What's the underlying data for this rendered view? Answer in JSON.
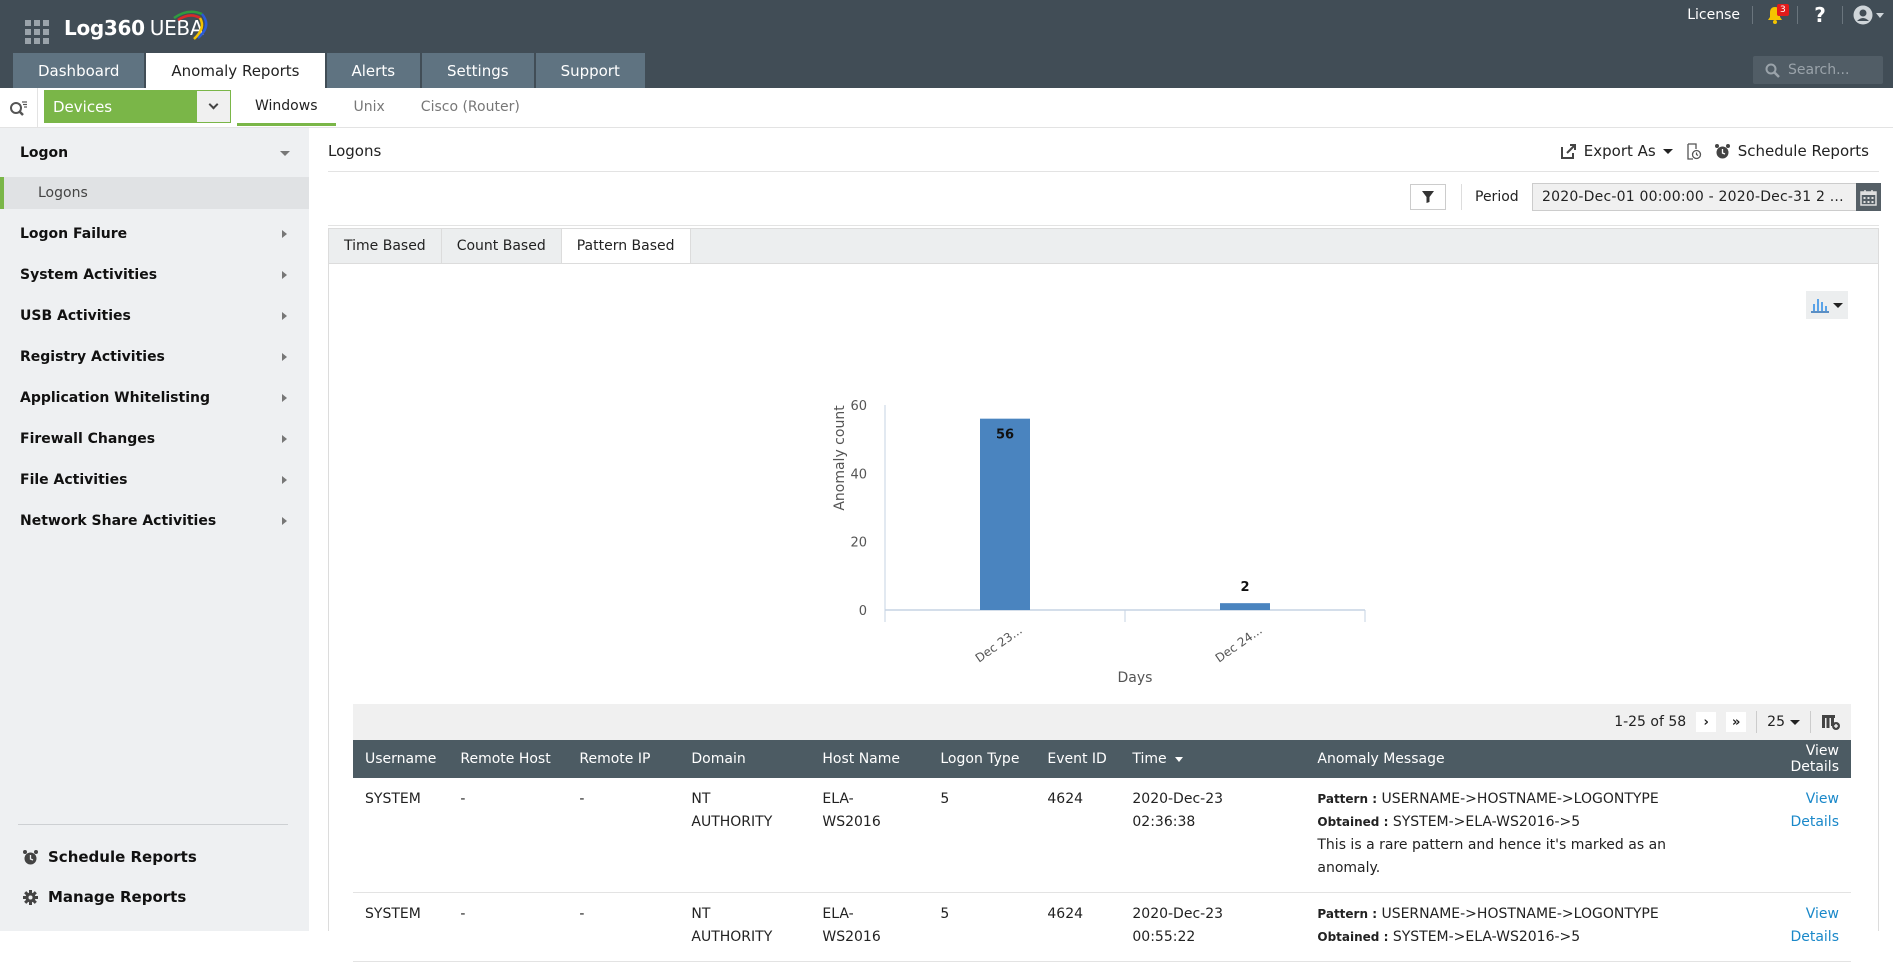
{
  "header": {
    "app_name": "Log360",
    "app_suffix": "UEBA",
    "license_label": "License",
    "notification_count": "3",
    "help_label": "?",
    "search_placeholder": "Search...",
    "main_tabs": [
      {
        "label": "Dashboard",
        "active": false
      },
      {
        "label": "Anomaly Reports",
        "active": true
      },
      {
        "label": "Alerts",
        "active": false
      },
      {
        "label": "Settings",
        "active": false
      },
      {
        "label": "Support",
        "active": false
      }
    ]
  },
  "subnav": {
    "category_select": "Devices",
    "os_tabs": [
      {
        "label": "Windows",
        "active": true
      },
      {
        "label": "Unix",
        "active": false
      },
      {
        "label": "Cisco (Router)",
        "active": false
      }
    ]
  },
  "sidebar": {
    "groups": [
      {
        "label": "Logon",
        "expanded": true
      },
      {
        "label": "Logon Failure"
      },
      {
        "label": "System Activities"
      },
      {
        "label": "USB Activities"
      },
      {
        "label": "Registry Activities"
      },
      {
        "label": "Application Whitelisting"
      },
      {
        "label": "Firewall Changes"
      },
      {
        "label": "File Activities"
      },
      {
        "label": "Network Share Activities"
      }
    ],
    "active_subitem": "Logons",
    "bottom": {
      "schedule_reports": "Schedule Reports",
      "manage_reports": "Manage Reports"
    }
  },
  "content": {
    "title": "Logons",
    "export_label": "Export As",
    "schedule_label": "Schedule Reports",
    "period_label": "Period",
    "period_value": "2020-Dec-01 00:00:00 - 2020-Dec-31 2 ...",
    "report_tabs": [
      {
        "label": "Time Based",
        "active": false
      },
      {
        "label": "Count Based",
        "active": false
      },
      {
        "label": "Pattern Based",
        "active": true
      }
    ]
  },
  "chart_data": {
    "type": "bar",
    "categories": [
      "Dec 23...",
      "Dec 24..."
    ],
    "values": [
      56,
      2
    ],
    "data_labels": [
      "56",
      "2"
    ],
    "title": "",
    "xlabel": "Days",
    "ylabel": "Anomaly count",
    "ylim": [
      0,
      60
    ],
    "yticks": [
      0,
      20,
      40,
      60
    ],
    "grid": false,
    "legend": "none",
    "color": "#4a84bf"
  },
  "table": {
    "pager_text": "1-25 of 58",
    "page_size": "25",
    "columns": [
      "Username",
      "Remote Host",
      "Remote IP",
      "Domain",
      "Host Name",
      "Logon Type",
      "Event ID",
      "Time",
      "Anomaly Message",
      "View Details"
    ],
    "rows": [
      {
        "username": "SYSTEM",
        "remote_host": "-",
        "remote_ip": "-",
        "domain_line1": "NT",
        "domain_line2": "AUTHORITY",
        "host_line1": "ELA-",
        "host_line2": "WS2016",
        "logon_type": "5",
        "event_id": "4624",
        "time_line1": "2020-Dec-23",
        "time_line2": "02:36:38",
        "pattern_label": "Pattern :",
        "pattern_value": "USERNAME->HOSTNAME->LOGONTYPE",
        "obtained_label": "Obtained :",
        "obtained_value": "SYSTEM->ELA-WS2016->5",
        "message": "This is a rare pattern and hence it's marked as an anomaly.",
        "link": "View Details"
      },
      {
        "username": "SYSTEM",
        "remote_host": "-",
        "remote_ip": "-",
        "domain_line1": "NT",
        "domain_line2": "AUTHORITY",
        "host_line1": "ELA-",
        "host_line2": "WS2016",
        "logon_type": "5",
        "event_id": "4624",
        "time_line1": "2020-Dec-23",
        "time_line2": "00:55:22",
        "pattern_label": "Pattern :",
        "pattern_value": "USERNAME->HOSTNAME->LOGONTYPE",
        "obtained_label": "Obtained :",
        "obtained_value": "SYSTEM->ELA-WS2016->5",
        "message": "",
        "link": "View Details"
      }
    ]
  }
}
